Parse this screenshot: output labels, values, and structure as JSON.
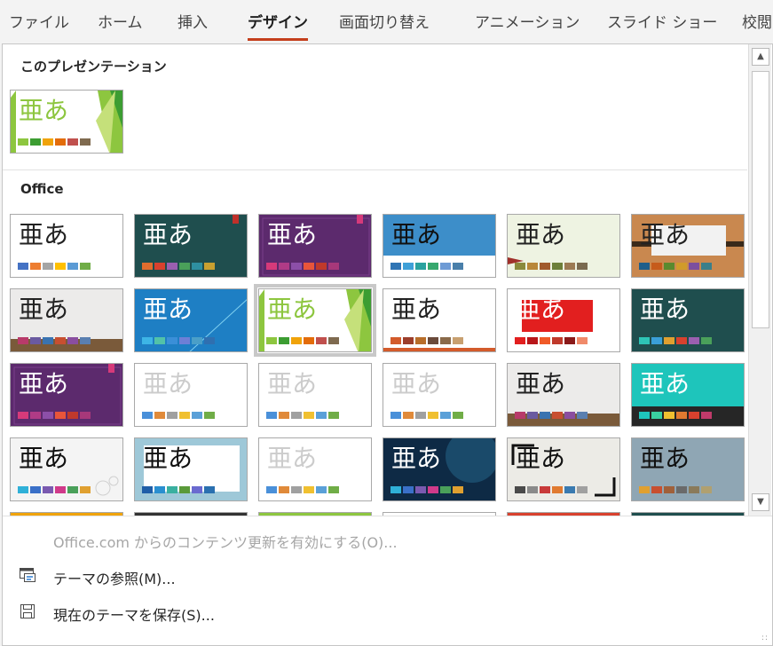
{
  "ribbon": {
    "tabs": [
      {
        "label": "ファイル",
        "active": false
      },
      {
        "label": "ホーム",
        "active": false
      },
      {
        "label": "挿入",
        "active": false
      },
      {
        "label": "デザイン",
        "active": true
      },
      {
        "label": "画面切り替え",
        "active": false
      },
      {
        "label": "アニメーション",
        "active": false
      },
      {
        "label": "スライド ショー",
        "active": false
      },
      {
        "label": "校閲",
        "active": false
      }
    ]
  },
  "gallery": {
    "this_presentation_label": "このプレゼンテーション",
    "office_label": "Office",
    "sample_text": "亜あ",
    "current_theme": {
      "title_color": "#8dc63f",
      "swatches": [
        "#8dc63f",
        "#3c9d32",
        "#f0a30a",
        "#e36c0a",
        "#c0504d",
        "#7f6a4f"
      ]
    },
    "themes": [
      {
        "name": "office-theme",
        "bg": "#ffffff",
        "text": "#222222",
        "swatches": [
          "#4472c4",
          "#ed7d31",
          "#a5a5a5",
          "#ffc000",
          "#5b9bd5",
          "#70ad47"
        ]
      },
      {
        "name": "dark-teal",
        "bg": "#1f4e4e",
        "text": "#ffffff",
        "swatches": [
          "#e06d2e",
          "#d8412e",
          "#9a5fb0",
          "#4aa05a",
          "#2e8fa0",
          "#c8a030"
        ]
      },
      {
        "name": "purple-frame",
        "bg": "#5c2a6d",
        "text": "#ffffff",
        "swatches": [
          "#d63a7a",
          "#b03b86",
          "#8c4fa8",
          "#e8553a",
          "#c0392b",
          "#a7387a"
        ]
      },
      {
        "name": "blue-pattern",
        "bg": "#3d8ec9",
        "text": "#111111",
        "swatches": [
          "#2f75b5",
          "#3ea0d8",
          "#2aa29f",
          "#37a86e",
          "#6e9bd5",
          "#4a7faa"
        ]
      },
      {
        "name": "sage",
        "bg": "#eef3e2",
        "text": "#222222",
        "swatches": [
          "#8a8a3c",
          "#b8873a",
          "#a05a2c",
          "#6d7f3a",
          "#9c7a54",
          "#7a6a50"
        ]
      },
      {
        "name": "wood-band",
        "bg": "#c9884f",
        "text": "#222222",
        "swatches": [
          "#1f5e8a",
          "#c65b1b",
          "#5a8a2e",
          "#d19b2a",
          "#7c4f9e",
          "#3a7f8a"
        ]
      },
      {
        "name": "gray-wood",
        "bg": "#ecebea",
        "text": "#222222",
        "swatches": [
          "#b83a6a",
          "#6a5aa0",
          "#3a73b0",
          "#c84f30",
          "#8a4ea0",
          "#5a7fb0"
        ]
      },
      {
        "name": "blue-gradient",
        "bg": "#1e7fc4",
        "text": "#ffffff",
        "swatches": [
          "#3db5e6",
          "#52c2a8",
          "#3a8fd8",
          "#6d7fd6",
          "#4a9fc8",
          "#2f6fb0"
        ]
      },
      {
        "name": "green-facet",
        "bg": "#ffffff",
        "text": "#8dc63f",
        "swatches": [
          "#8dc63f",
          "#3c9d32",
          "#f0a30a",
          "#e36c0a",
          "#c0504d",
          "#7f6a4f"
        ]
      },
      {
        "name": "orange-line",
        "bg": "#ffffff",
        "text": "#222222",
        "swatches": [
          "#d35b2b",
          "#9c3e2b",
          "#b86e2a",
          "#6a4a3a",
          "#8a6a4a",
          "#c8a070"
        ]
      },
      {
        "name": "red-block",
        "bg": "#ffffff",
        "text": "#ffffff",
        "swatches": [
          "#e21f1f",
          "#b8161a",
          "#f05a28",
          "#c0392b",
          "#8a1a1a",
          "#f08a6a"
        ]
      },
      {
        "name": "dark-teal-2",
        "bg": "#1f4e4e",
        "text": "#ffffff",
        "swatches": [
          "#2ec4b6",
          "#3a9fd8",
          "#e0a030",
          "#d8412e",
          "#9a5fb0",
          "#4aa05a"
        ]
      },
      {
        "name": "purple-frame-2",
        "bg": "#5c2a6d",
        "text": "#ffffff",
        "swatches": [
          "#d63a7a",
          "#b03b86",
          "#8c4fa8",
          "#e8553a",
          "#c0392b",
          "#a7387a"
        ]
      },
      {
        "name": "faded-1",
        "bg": "#ffffff",
        "text": "#cccccc",
        "swatches": [
          "#4a90d9",
          "#e08a3a",
          "#a0a0a0",
          "#f0c030",
          "#5aa0d8",
          "#70ad47"
        ]
      },
      {
        "name": "faded-2",
        "bg": "#ffffff",
        "text": "#cccccc",
        "swatches": [
          "#4a90d9",
          "#e08a3a",
          "#a0a0a0",
          "#f0c030",
          "#5aa0d8",
          "#70ad47"
        ]
      },
      {
        "name": "faded-3",
        "bg": "#ffffff",
        "text": "#cccccc",
        "swatches": [
          "#4a90d9",
          "#e08a3a",
          "#a0a0a0",
          "#f0c030",
          "#5aa0d8",
          "#70ad47"
        ]
      },
      {
        "name": "gray-wood-2",
        "bg": "#ecebea",
        "text": "#222222",
        "swatches": [
          "#b83a6a",
          "#6a5aa0",
          "#3a73b0",
          "#c84f30",
          "#8a4ea0",
          "#5a7fb0"
        ]
      },
      {
        "name": "teal-dark",
        "bg": "#1ec5bb",
        "text": "#ffffff",
        "swatches": [
          "#1ec5bb",
          "#3ad0a0",
          "#f0c030",
          "#e07a30",
          "#d8412e",
          "#c03a6a"
        ]
      },
      {
        "name": "drops",
        "bg": "#f4f4f4",
        "text": "#111111",
        "swatches": [
          "#2fb0d8",
          "#3a70c8",
          "#7a5ab0",
          "#d03a8a",
          "#4aa05a",
          "#e0a030"
        ]
      },
      {
        "name": "blue-pattern-2",
        "bg": "#9ec8d8",
        "text": "#111111",
        "swatches": [
          "#1f5ea8",
          "#2a8fd0",
          "#3ab0a0",
          "#5a9a3a",
          "#6a6ad0",
          "#2a70b0"
        ]
      },
      {
        "name": "faded-4",
        "bg": "#ffffff",
        "text": "#cccccc",
        "swatches": [
          "#4a90d9",
          "#e08a3a",
          "#a0a0a0",
          "#f0c030",
          "#5aa0d8",
          "#70ad47"
        ]
      },
      {
        "name": "dark-blue",
        "bg": "#0e2a45",
        "text": "#ffffff",
        "swatches": [
          "#2fb0d8",
          "#3a70c8",
          "#7a5ab0",
          "#d03a8a",
          "#4aa05a",
          "#e0a030"
        ]
      },
      {
        "name": "frame-black",
        "bg": "#ecebe6",
        "text": "#111111",
        "swatches": [
          "#4a4a4a",
          "#8a8a8a",
          "#c83a3a",
          "#e07a30",
          "#3a7ab0",
          "#a0a0a0"
        ]
      },
      {
        "name": "slate",
        "bg": "#8fa6b4",
        "text": "#111111",
        "swatches": [
          "#e0a030",
          "#c84f30",
          "#a0603a",
          "#6a6a6a",
          "#8a7a5a",
          "#b0a070"
        ]
      }
    ],
    "next_row_colors": [
      "#f0a30a",
      "#333333",
      "#8dc63f",
      "#ffffff",
      "#d8412e",
      "#1f4e4e"
    ]
  },
  "commands": [
    {
      "label": "Office.com からのコンテンツ更新を有効にする(O)...",
      "enabled": false
    },
    {
      "label": "テーマの参照(M)...",
      "enabled": true
    },
    {
      "label": "現在のテーマを保存(S)...",
      "enabled": true
    }
  ],
  "scrollbar": {
    "up_icon": "▲",
    "down_icon": "▼"
  },
  "resize_grip": "::",
  "colors": {
    "accent": "#c43e1c",
    "selected_outline": "#c8c8c8"
  }
}
